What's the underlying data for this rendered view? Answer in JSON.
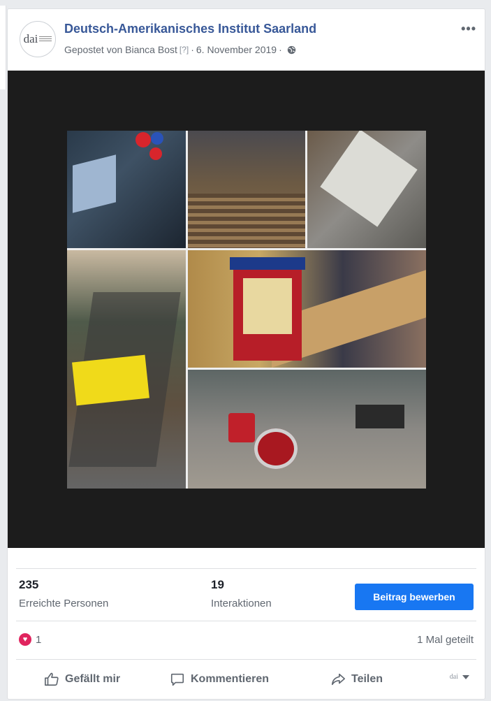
{
  "post": {
    "page_name": "Deutsch-Amerikanisches Institut Saarland",
    "avatar_text": "dai",
    "posted_by": "Gepostet von Bianca Bost",
    "help_mark": "[?]",
    "separator": "·",
    "date": "6. November 2019",
    "more_label": "•••"
  },
  "stats": {
    "reach_value": "235",
    "reach_label": "Erreichte Personen",
    "interactions_value": "19",
    "interactions_label": "Interaktionen",
    "boost_label": "Beitrag bewerben"
  },
  "reactions": {
    "count": "1",
    "shares": "1 Mal geteilt"
  },
  "actions": {
    "like": "Gefällt mir",
    "comment": "Kommentieren",
    "share": "Teilen",
    "page_selector_text": "dai"
  },
  "colors": {
    "link_blue": "#385898",
    "button_blue": "#1877f2",
    "photo_background": "#1c1c1c",
    "reaction_red": "#e0245e"
  },
  "icons": [
    "globe-icon",
    "more-icon",
    "heart-reaction-icon",
    "like-icon",
    "comment-icon",
    "share-icon",
    "chevron-down-icon"
  ]
}
